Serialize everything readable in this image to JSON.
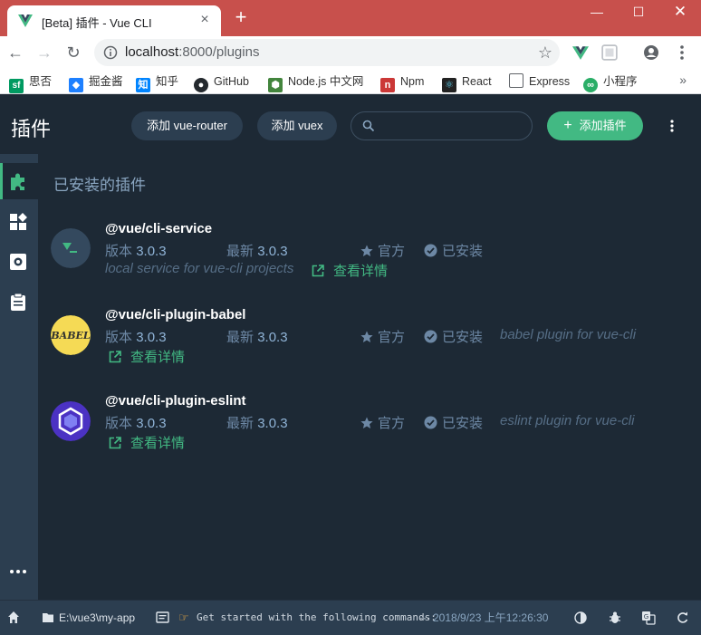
{
  "browser": {
    "tab_title": "[Beta] 插件 - Vue CLI",
    "url_host": "localhost",
    "url_path": ":8000/plugins",
    "bookmarks": [
      {
        "label": "思否",
        "icon": "segmentfault-icon",
        "color": "#009a61"
      },
      {
        "label": "掘金酱",
        "icon": "juejin-icon",
        "color": "#1e80ff"
      },
      {
        "label": "知乎",
        "icon": "zhihu-icon",
        "color": "#0084ff"
      },
      {
        "label": "GitHub",
        "icon": "github-icon",
        "color": "#24292e"
      },
      {
        "label": "Node.js 中文网",
        "icon": "nodejs-icon",
        "color": "#43853d"
      },
      {
        "label": "Npm",
        "icon": "npm-icon",
        "color": "#cb3837"
      },
      {
        "label": "React",
        "icon": "react-icon",
        "color": "#222222"
      },
      {
        "label": "Express",
        "icon": "document-icon",
        "color": "#5f6368"
      },
      {
        "label": "小程序",
        "icon": "miniprogram-icon",
        "color": "#2aae67"
      }
    ]
  },
  "header": {
    "title": "插件",
    "btn_router": "添加 vue-router",
    "btn_vuex": "添加 vuex",
    "search_placeholder": "",
    "add_plugin": "添加插件"
  },
  "section_title": "已安装的插件",
  "plugins": [
    {
      "name": "@vue/cli-service",
      "version_label": "版本",
      "version": "3.0.3",
      "latest_label": "最新",
      "latest": "3.0.3",
      "official": "官方",
      "installed": "已安装",
      "description": "local service for vue-cli projects",
      "details": "查看详情"
    },
    {
      "name": "@vue/cli-plugin-babel",
      "version_label": "版本",
      "version": "3.0.3",
      "latest_label": "最新",
      "latest": "3.0.3",
      "official": "官方",
      "installed": "已安装",
      "description": "babel plugin for vue-cli",
      "details": "查看详情",
      "logo_text": "BABEL"
    },
    {
      "name": "@vue/cli-plugin-eslint",
      "version_label": "版本",
      "version": "3.0.3",
      "latest_label": "最新",
      "latest": "3.0.3",
      "official": "官方",
      "installed": "已安装",
      "description": "eslint plugin for vue-cli",
      "details": "查看详情"
    }
  ],
  "status": {
    "path": "E:\\vue3\\my-app",
    "log": "Get started with the following commands: ",
    "ellipsis": "···",
    "time": "2018/9/23  上午12:26:30"
  },
  "colors": {
    "accent": "#42b983",
    "background": "#1d2935",
    "sidebar": "#2c3e50",
    "titlebar": "#c8504c"
  }
}
